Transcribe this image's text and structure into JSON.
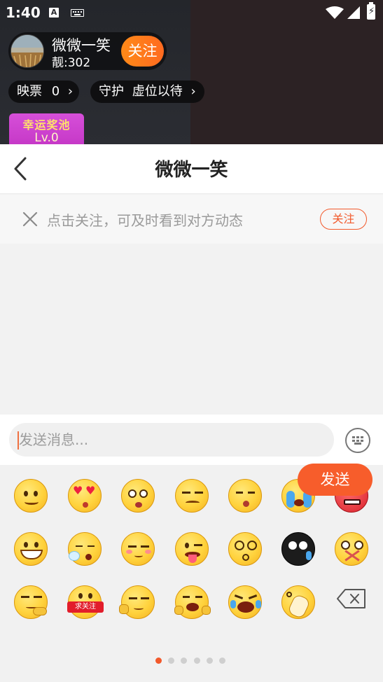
{
  "status_bar": {
    "time": "1:40",
    "a_icon_text": "A"
  },
  "live_room": {
    "host_name": "微微一笑",
    "host_stat": "靓:302",
    "follow_label": "关注",
    "ticket_label": "映票",
    "ticket_count": "0",
    "guard_label": "守护",
    "guard_value": "虚位以待",
    "lucky_pool_title": "幸运奖池",
    "lucky_pool_level": "Lv.0"
  },
  "chat": {
    "title": "微微一笑",
    "follow_tip_text": "点击关注，可及时看到对方动态",
    "follow_tip_button": "关注",
    "input_placeholder": "发送消息...",
    "send_label": "发送"
  },
  "emoji_panel": {
    "rows": [
      [
        "smile-emoji",
        "heart-eyes-kiss-emoji",
        "drool-emoji",
        "disdain-emoji",
        "shh-emoji",
        "crying-emoji",
        "angry-emoji"
      ],
      [
        "grin-emoji",
        "sleepy-emoji",
        "shy-emoji",
        "tongue-wink-emoji",
        "dizzy-emoji",
        "black-sweat-emoji",
        "mouth-zipped-emoji"
      ],
      [
        "thinking-emoji",
        "beg-follow-emoji",
        "smirk-emoji",
        "giggle-emoji",
        "laugh-cry-emoji",
        "facepalm-emoji",
        "backspace-icon"
      ]
    ],
    "beg_follow_text": "求关注",
    "pages": 6,
    "active_page": 1
  },
  "colors": {
    "accent": "#f75d2b",
    "follow_orange": "#ff7a1e",
    "header_text": "#222222",
    "tip_text": "#9a9a9a"
  }
}
